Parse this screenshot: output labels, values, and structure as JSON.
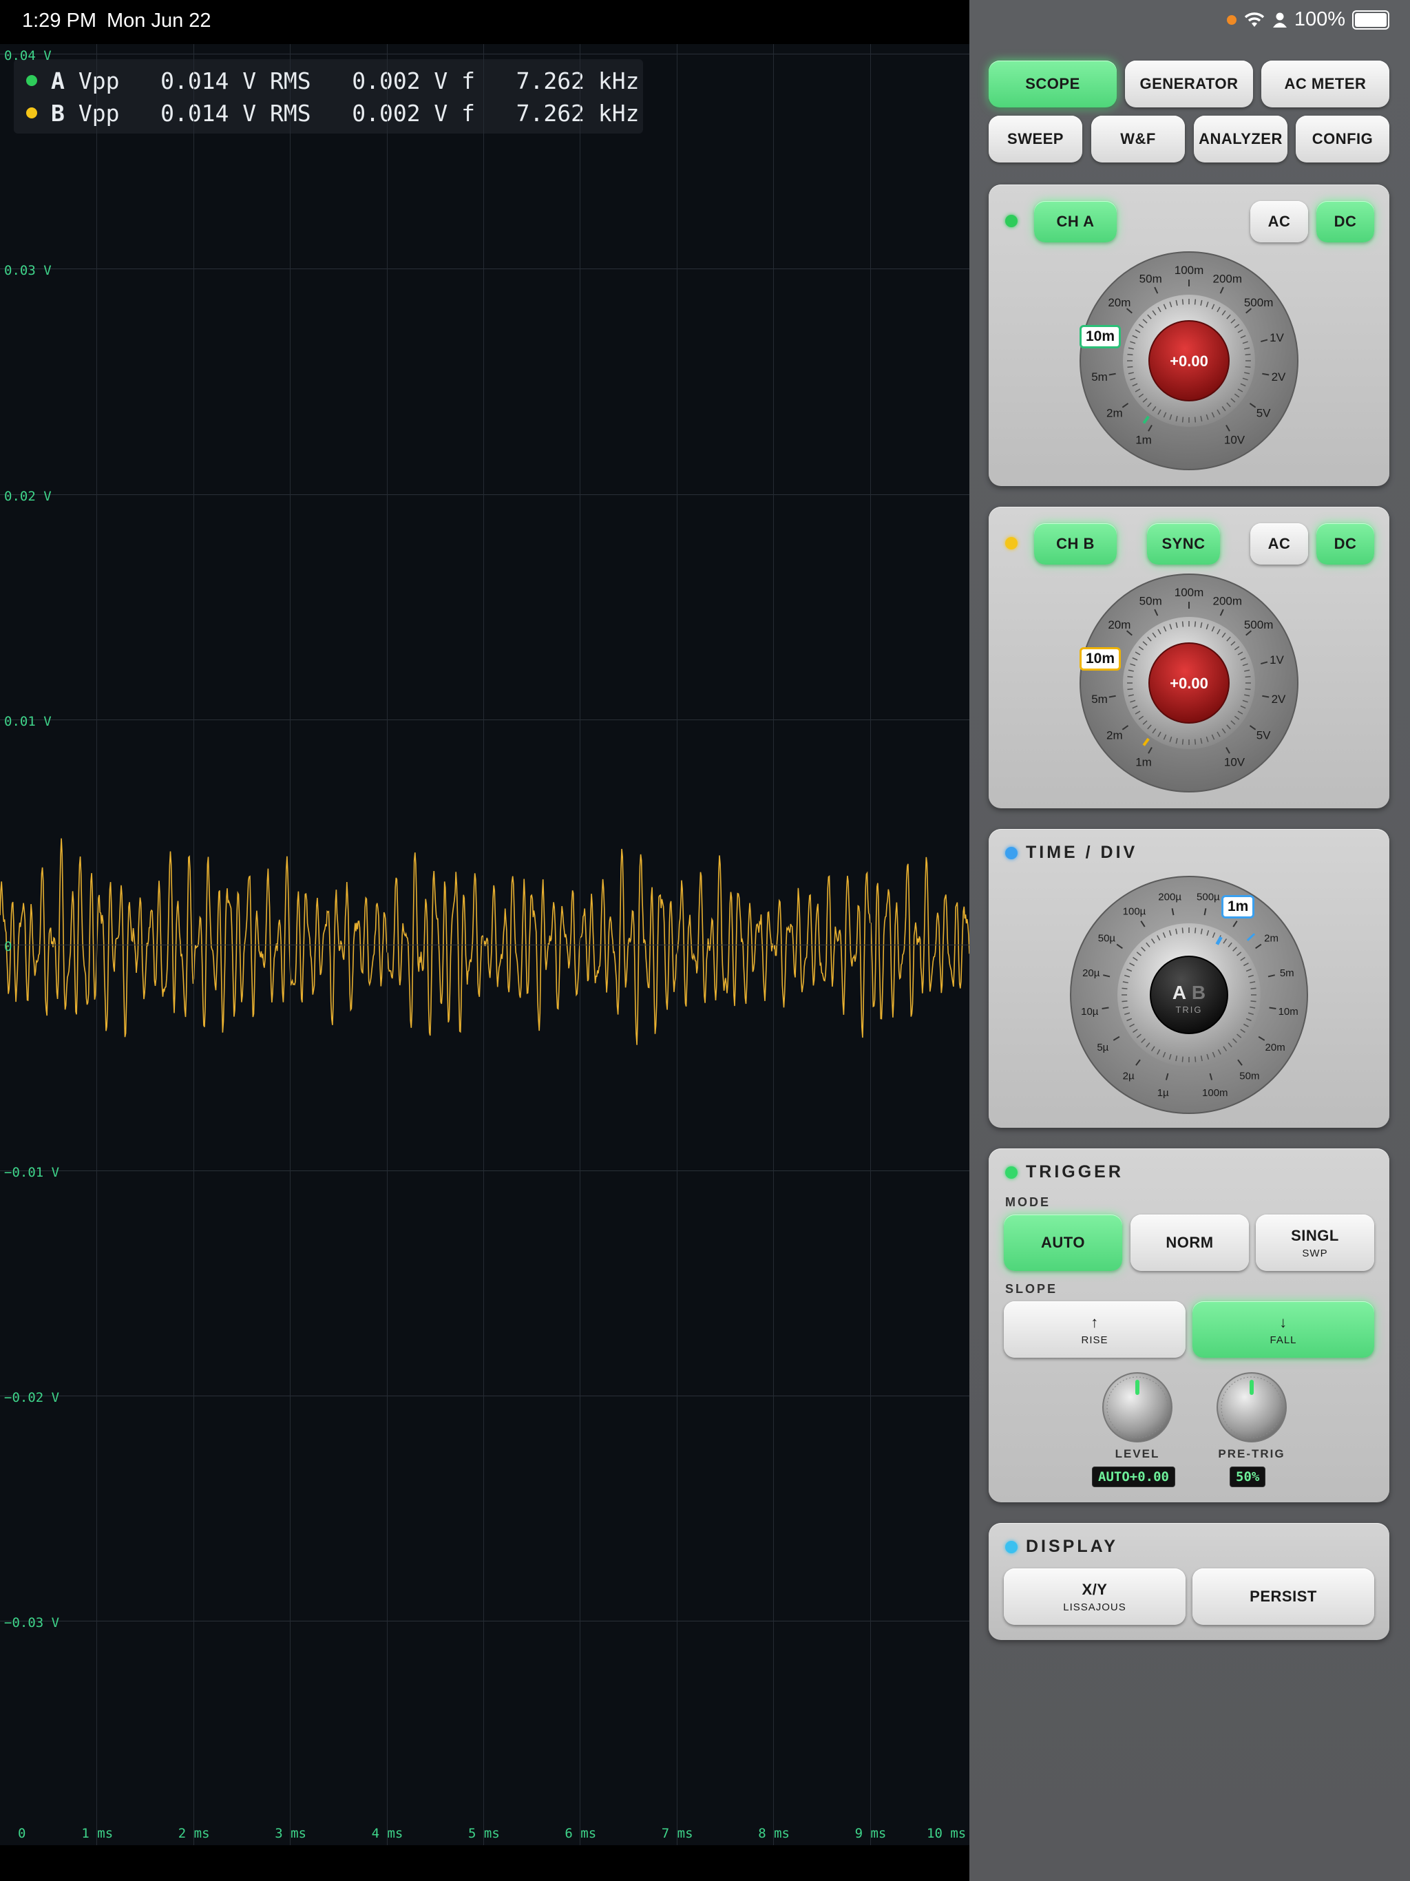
{
  "status": {
    "time": "1:29 PM",
    "date": "Mon Jun 22",
    "battery": "100%"
  },
  "readout": {
    "rows": [
      {
        "ch": "A",
        "color": "#2ecc5a",
        "text": "Vpp   0.014 V RMS   0.002 V f   7.262 kHz"
      },
      {
        "ch": "B",
        "color": "#f5c518",
        "text": "Vpp   0.014 V RMS   0.002 V f   7.262 kHz"
      }
    ]
  },
  "axis": {
    "y_labels": [
      "0.04 V",
      "0.03 V",
      "0.02 V",
      "0.01 V",
      "0",
      "−0.01 V",
      "−0.02 V",
      "−0.03 V"
    ],
    "x_labels": [
      "0",
      "1 ms",
      "2 ms",
      "3 ms",
      "4 ms",
      "5 ms",
      "6 ms",
      "7 ms",
      "8 ms",
      "9 ms",
      "10 ms"
    ]
  },
  "nav": {
    "row1": [
      {
        "label": "SCOPE",
        "active": true
      },
      {
        "label": "GENERATOR",
        "active": false
      },
      {
        "label": "AC METER",
        "active": false
      }
    ],
    "row2": [
      {
        "label": "SWEEP",
        "active": false
      },
      {
        "label": "W&F",
        "active": false
      },
      {
        "label": "ANALYZER",
        "active": false
      },
      {
        "label": "CONFIG",
        "active": false
      }
    ]
  },
  "cha": {
    "name": "CH A",
    "ac": "AC",
    "dc": "DC",
    "led": "#2ecc5a",
    "value": "10m",
    "offset": "+0.00",
    "accent": "#2bbf77"
  },
  "chb": {
    "name": "CH B",
    "sync": "SYNC",
    "ac": "AC",
    "dc": "DC",
    "led": "#f5c518",
    "value": "10m",
    "offset": "+0.00",
    "accent": "#f0b400"
  },
  "volt_dial_labels": [
    "1m",
    "2m",
    "5m",
    "10m",
    "20m",
    "50m",
    "100m",
    "200m",
    "500m",
    "1V",
    "2V",
    "5V",
    "10V"
  ],
  "time": {
    "title": "TIME / DIV",
    "led": "#3aa0f0",
    "value": "1m",
    "center_a": "A",
    "center_b": "B",
    "center_sub": "TRIG",
    "labels": [
      "1µ",
      "2µ",
      "5µ",
      "10µ",
      "20µ",
      "50µ",
      "100µ",
      "200µ",
      "500µ",
      "1m",
      "2m",
      "5m",
      "10m",
      "20m",
      "50m",
      "100m"
    ]
  },
  "trigger": {
    "title": "TRIGGER",
    "led": "#34d86a",
    "mode_label": "MODE",
    "slope_label": "SLOPE",
    "modes": [
      {
        "label": "AUTO",
        "sub": "",
        "active": true
      },
      {
        "label": "NORM",
        "sub": "",
        "active": false
      },
      {
        "label": "SINGL",
        "sub": "SWP",
        "active": false
      }
    ],
    "slopes": [
      {
        "icon": "↑",
        "label": "RISE",
        "active": false
      },
      {
        "icon": "↓",
        "label": "FALL",
        "active": true
      }
    ],
    "level_label": "LEVEL",
    "level_value": "AUTO+0.00",
    "pretrig_label": "PRE-TRIG",
    "pretrig_value": "50%"
  },
  "display": {
    "title": "DISPLAY",
    "led": "#3ac0f0",
    "buttons": [
      {
        "label": "X/Y",
        "sub": "LISSAJOUS"
      },
      {
        "label": "PERSIST",
        "sub": ""
      }
    ]
  },
  "colors": {
    "trace": "#e8b030",
    "grid": "#252b33",
    "axis_text": "#3fd48a"
  }
}
